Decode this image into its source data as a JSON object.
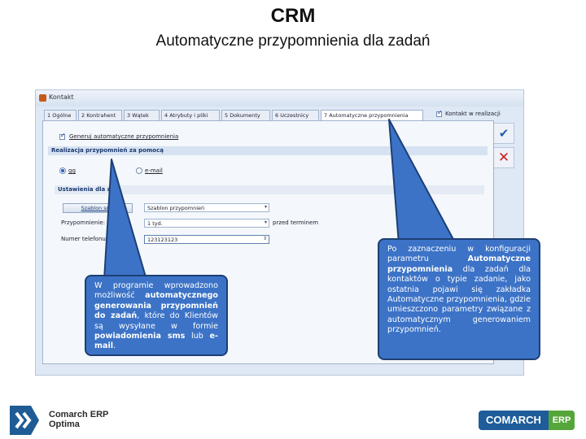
{
  "slide": {
    "title": "CRM",
    "subtitle": "Automatyczne przypomnienia dla zadań"
  },
  "window": {
    "title": "Kontakt",
    "tabs": [
      {
        "label": "1 Ogólne"
      },
      {
        "label": "2 Kontrahent"
      },
      {
        "label": "3 Wątek"
      },
      {
        "label": "4 Atrybuty i pliki"
      },
      {
        "label": "5 Dokumenty"
      },
      {
        "label": "6 Uczestnicy"
      },
      {
        "label": "7 Automatyczne przypomnienia"
      }
    ],
    "side_checkbox_label": "Kontakt w realizacji",
    "generate_checkbox_label": "Generuj automatyczne przypomnienia",
    "delivery_group_header": "Realizacja przypomnień za pomocą",
    "radio_gg": "gg",
    "radio_email": "e-mail",
    "settings_group_header": "Ustawienia dla a",
    "sms_template_button": "Szablon sms",
    "template_combo_value": "Szablon przypomnień",
    "reminder_label": "Przypomnienie:",
    "reminder_value": "1 tyd.",
    "before_deadline_label": "przed terminem",
    "phone_label": "Numer telefonu:",
    "phone_value": "123123123"
  },
  "callouts": {
    "left": {
      "p1": "W programie wprowadzono możliwość ",
      "b1": "automatycznego generowania przypomnień do zadań",
      "p2": ", które do Klientów są wysyłane w formie ",
      "b2": "powiadomienia sms",
      "p3": " lub ",
      "b3": "e-mail",
      "p4": "."
    },
    "right": {
      "p1": "Po zaznaczeniu w konfiguracji parametru ",
      "b1": "Automatyczne przypomnienia",
      "p2": " dla zadań dla kontaktów o typie zadanie, jako ostatnia pojawi się zakładka Automatyczne przypomnienia, gdzie umieszczono parametry związane z automatycznym generowaniem przypomnień."
    }
  },
  "footer": {
    "logo_left_line1": "Comarch ERP",
    "logo_left_line2": "Optima",
    "logo_right_main": "COMARCH",
    "logo_right_erp": "ERP"
  },
  "colors": {
    "callout_fill": "#3c73c7",
    "callout_border": "#1d3f74",
    "logo_blue": "#1e5c9a",
    "logo_green": "#54a63a"
  }
}
